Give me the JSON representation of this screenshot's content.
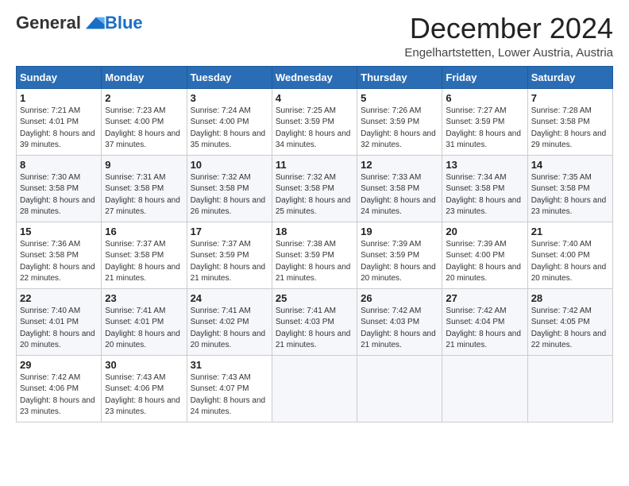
{
  "logo": {
    "general": "General",
    "blue": "Blue"
  },
  "header": {
    "month": "December 2024",
    "location": "Engelhartstetten, Lower Austria, Austria"
  },
  "days_of_week": [
    "Sunday",
    "Monday",
    "Tuesday",
    "Wednesday",
    "Thursday",
    "Friday",
    "Saturday"
  ],
  "weeks": [
    [
      {
        "day": "1",
        "sunrise": "7:21 AM",
        "sunset": "4:01 PM",
        "daylight": "8 hours and 39 minutes."
      },
      {
        "day": "2",
        "sunrise": "7:23 AM",
        "sunset": "4:00 PM",
        "daylight": "8 hours and 37 minutes."
      },
      {
        "day": "3",
        "sunrise": "7:24 AM",
        "sunset": "4:00 PM",
        "daylight": "8 hours and 35 minutes."
      },
      {
        "day": "4",
        "sunrise": "7:25 AM",
        "sunset": "3:59 PM",
        "daylight": "8 hours and 34 minutes."
      },
      {
        "day": "5",
        "sunrise": "7:26 AM",
        "sunset": "3:59 PM",
        "daylight": "8 hours and 32 minutes."
      },
      {
        "day": "6",
        "sunrise": "7:27 AM",
        "sunset": "3:59 PM",
        "daylight": "8 hours and 31 minutes."
      },
      {
        "day": "7",
        "sunrise": "7:28 AM",
        "sunset": "3:58 PM",
        "daylight": "8 hours and 29 minutes."
      }
    ],
    [
      {
        "day": "8",
        "sunrise": "7:30 AM",
        "sunset": "3:58 PM",
        "daylight": "8 hours and 28 minutes."
      },
      {
        "day": "9",
        "sunrise": "7:31 AM",
        "sunset": "3:58 PM",
        "daylight": "8 hours and 27 minutes."
      },
      {
        "day": "10",
        "sunrise": "7:32 AM",
        "sunset": "3:58 PM",
        "daylight": "8 hours and 26 minutes."
      },
      {
        "day": "11",
        "sunrise": "7:32 AM",
        "sunset": "3:58 PM",
        "daylight": "8 hours and 25 minutes."
      },
      {
        "day": "12",
        "sunrise": "7:33 AM",
        "sunset": "3:58 PM",
        "daylight": "8 hours and 24 minutes."
      },
      {
        "day": "13",
        "sunrise": "7:34 AM",
        "sunset": "3:58 PM",
        "daylight": "8 hours and 23 minutes."
      },
      {
        "day": "14",
        "sunrise": "7:35 AM",
        "sunset": "3:58 PM",
        "daylight": "8 hours and 23 minutes."
      }
    ],
    [
      {
        "day": "15",
        "sunrise": "7:36 AM",
        "sunset": "3:58 PM",
        "daylight": "8 hours and 22 minutes."
      },
      {
        "day": "16",
        "sunrise": "7:37 AM",
        "sunset": "3:58 PM",
        "daylight": "8 hours and 21 minutes."
      },
      {
        "day": "17",
        "sunrise": "7:37 AM",
        "sunset": "3:59 PM",
        "daylight": "8 hours and 21 minutes."
      },
      {
        "day": "18",
        "sunrise": "7:38 AM",
        "sunset": "3:59 PM",
        "daylight": "8 hours and 21 minutes."
      },
      {
        "day": "19",
        "sunrise": "7:39 AM",
        "sunset": "3:59 PM",
        "daylight": "8 hours and 20 minutes."
      },
      {
        "day": "20",
        "sunrise": "7:39 AM",
        "sunset": "4:00 PM",
        "daylight": "8 hours and 20 minutes."
      },
      {
        "day": "21",
        "sunrise": "7:40 AM",
        "sunset": "4:00 PM",
        "daylight": "8 hours and 20 minutes."
      }
    ],
    [
      {
        "day": "22",
        "sunrise": "7:40 AM",
        "sunset": "4:01 PM",
        "daylight": "8 hours and 20 minutes."
      },
      {
        "day": "23",
        "sunrise": "7:41 AM",
        "sunset": "4:01 PM",
        "daylight": "8 hours and 20 minutes."
      },
      {
        "day": "24",
        "sunrise": "7:41 AM",
        "sunset": "4:02 PM",
        "daylight": "8 hours and 20 minutes."
      },
      {
        "day": "25",
        "sunrise": "7:41 AM",
        "sunset": "4:03 PM",
        "daylight": "8 hours and 21 minutes."
      },
      {
        "day": "26",
        "sunrise": "7:42 AM",
        "sunset": "4:03 PM",
        "daylight": "8 hours and 21 minutes."
      },
      {
        "day": "27",
        "sunrise": "7:42 AM",
        "sunset": "4:04 PM",
        "daylight": "8 hours and 21 minutes."
      },
      {
        "day": "28",
        "sunrise": "7:42 AM",
        "sunset": "4:05 PM",
        "daylight": "8 hours and 22 minutes."
      }
    ],
    [
      {
        "day": "29",
        "sunrise": "7:42 AM",
        "sunset": "4:06 PM",
        "daylight": "8 hours and 23 minutes."
      },
      {
        "day": "30",
        "sunrise": "7:43 AM",
        "sunset": "4:06 PM",
        "daylight": "8 hours and 23 minutes."
      },
      {
        "day": "31",
        "sunrise": "7:43 AM",
        "sunset": "4:07 PM",
        "daylight": "8 hours and 24 minutes."
      },
      null,
      null,
      null,
      null
    ]
  ],
  "labels": {
    "sunrise": "Sunrise:",
    "sunset": "Sunset:",
    "daylight": "Daylight:"
  }
}
